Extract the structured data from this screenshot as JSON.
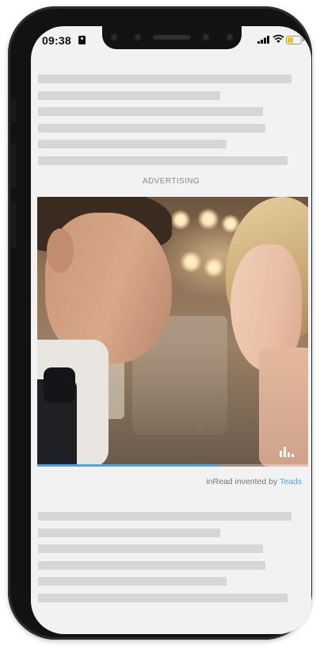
{
  "status_bar": {
    "time": "09:38",
    "icons": [
      "id-badge-icon",
      "signal-icon",
      "wifi-icon",
      "battery-icon"
    ],
    "battery_color": "#f3c316"
  },
  "ad": {
    "label": "ADVERTISING",
    "video_progress_percent": 67,
    "accent_color": "#4aa6e0",
    "credit_prefix": "inRead invented by ",
    "credit_brand": "Teads"
  }
}
